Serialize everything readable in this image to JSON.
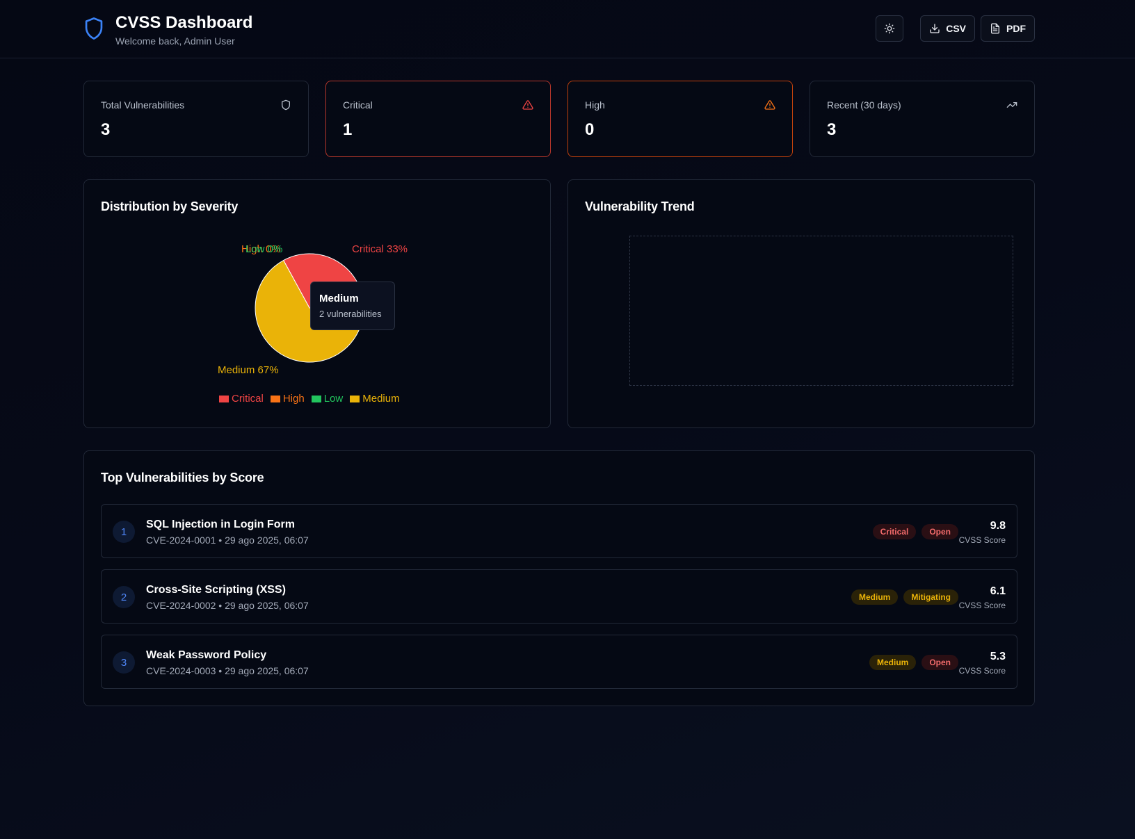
{
  "header": {
    "title": "CVSS Dashboard",
    "subtitle": "Welcome back, Admin User",
    "csv_label": "CSV",
    "pdf_label": "PDF"
  },
  "stats": [
    {
      "label": "Total Vulnerabilities",
      "value": "3",
      "icon": "shield-icon"
    },
    {
      "label": "Critical",
      "value": "1",
      "icon": "alert-triangle-icon",
      "color": "#ef4444"
    },
    {
      "label": "High",
      "value": "0",
      "icon": "alert-triangle-icon",
      "color": "#f97316"
    },
    {
      "label": "Recent (30 days)",
      "value": "3",
      "icon": "trending-up-icon"
    }
  ],
  "distribution": {
    "title": "Distribution by Severity",
    "tooltip": {
      "title": "Medium",
      "subtitle": "2 vulnerabilities"
    }
  },
  "chart_data": {
    "type": "pie",
    "categories": [
      "Critical",
      "High",
      "Low",
      "Medium"
    ],
    "values": [
      1,
      0,
      0,
      2
    ],
    "slice_labels": [
      "Critical 33%",
      "High 0%",
      "Low 0%",
      "Medium 67%"
    ],
    "colors": [
      "#ef4444",
      "#f97316",
      "#22c55e",
      "#eab308"
    ],
    "legend_position": "bottom"
  },
  "trend": {
    "title": "Vulnerability Trend"
  },
  "top": {
    "title": "Top Vulnerabilities by Score",
    "items": [
      {
        "rank": "1",
        "title": "SQL Injection in Login Form",
        "meta": "CVE-2024-0001 • 29 ago 2025, 06:07",
        "severity": "Critical",
        "status": "Open",
        "score": "9.8",
        "score_label": "CVSS Score"
      },
      {
        "rank": "2",
        "title": "Cross-Site Scripting (XSS)",
        "meta": "CVE-2024-0002 • 29 ago 2025, 06:07",
        "severity": "Medium",
        "status": "Mitigating",
        "score": "6.1",
        "score_label": "CVSS Score"
      },
      {
        "rank": "3",
        "title": "Weak Password Policy",
        "meta": "CVE-2024-0003 • 29 ago 2025, 06:07",
        "severity": "Medium",
        "status": "Open",
        "score": "5.3",
        "score_label": "CVSS Score"
      }
    ]
  }
}
